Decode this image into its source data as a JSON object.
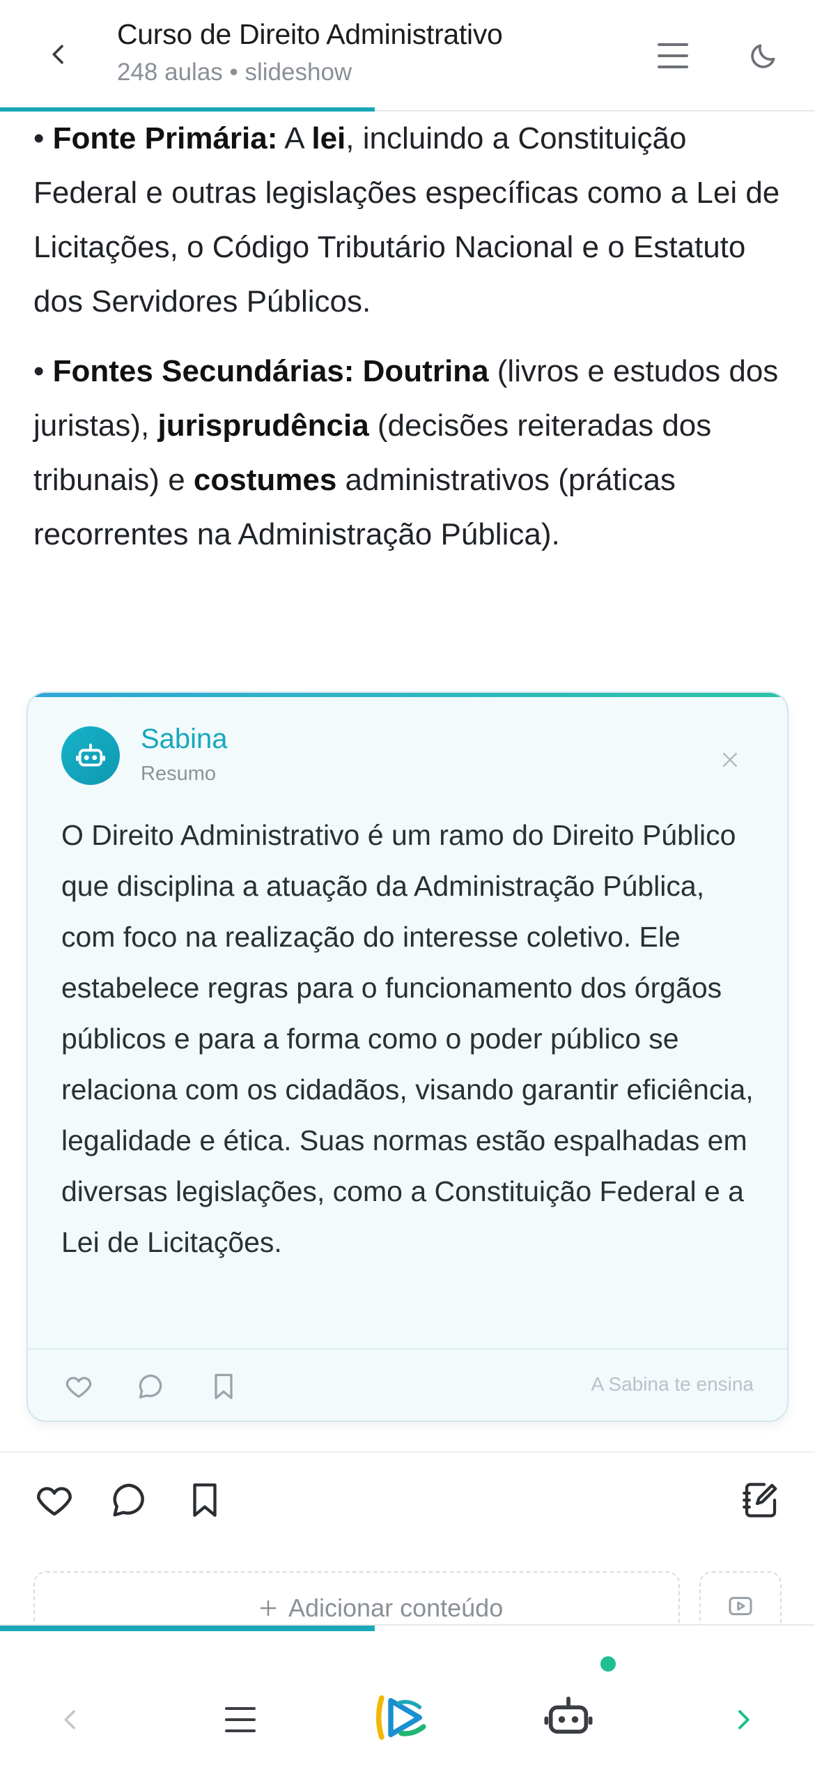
{
  "header": {
    "title": "Curso de Direito Administrativo",
    "subtitle": "248 aulas • slideshow"
  },
  "content": {
    "p1": {
      "bullet": "• ",
      "b1": "Fonte Primária:",
      "t1": " A ",
      "b2": "lei",
      "t2": ", incluindo a Constituição Federal e outras legislações específicas como a Lei de Licitações, o Código Tributário Nacional e o Estatuto dos Servidores Públicos."
    },
    "p2": {
      "bullet": "• ",
      "b1": "Fontes Secundárias:",
      "t1": " ",
      "b2": "Doutrina",
      "t2": " (livros e estudos dos juristas), ",
      "b3": "jurisprudência",
      "t3": " (decisões reiteradas dos tribunais) e ",
      "b4": "costumes",
      "t4": " administrativos (práticas recorrentes na Administração Pública)."
    }
  },
  "card": {
    "name": "Sabina",
    "label": "Resumo",
    "body": "O Direito Administrativo é um ramo do Direito Público que disciplina a atuação da Administração Pública, com foco na realização do interesse coletivo. Ele estabelece regras para o funcionamento dos órgãos públicos e para a forma como o poder público se relaciona com os cidadãos, visando garantir eficiência, legalidade e ética. Suas normas estão espalhadas em diversas legislações, como a Constituição Federal e a Lei de Licitações.",
    "footer": "A Sabina te ensina"
  },
  "add_content": {
    "label": "Adicionar conteúdo"
  },
  "lesson_progress": 0.46,
  "colors": {
    "accent": "#1aa7b7",
    "sabina": "#17a7be",
    "online_dot": "#1fbf8f"
  },
  "icons": {
    "back": "chevron-left-icon",
    "menu": "hamburger-icon",
    "theme": "moon-icon",
    "like": "heart-icon",
    "comment": "speech-bubble-icon",
    "save": "bookmark-icon",
    "notes": "notebook-edit-icon",
    "video": "video-icon",
    "bot": "robot-icon"
  }
}
